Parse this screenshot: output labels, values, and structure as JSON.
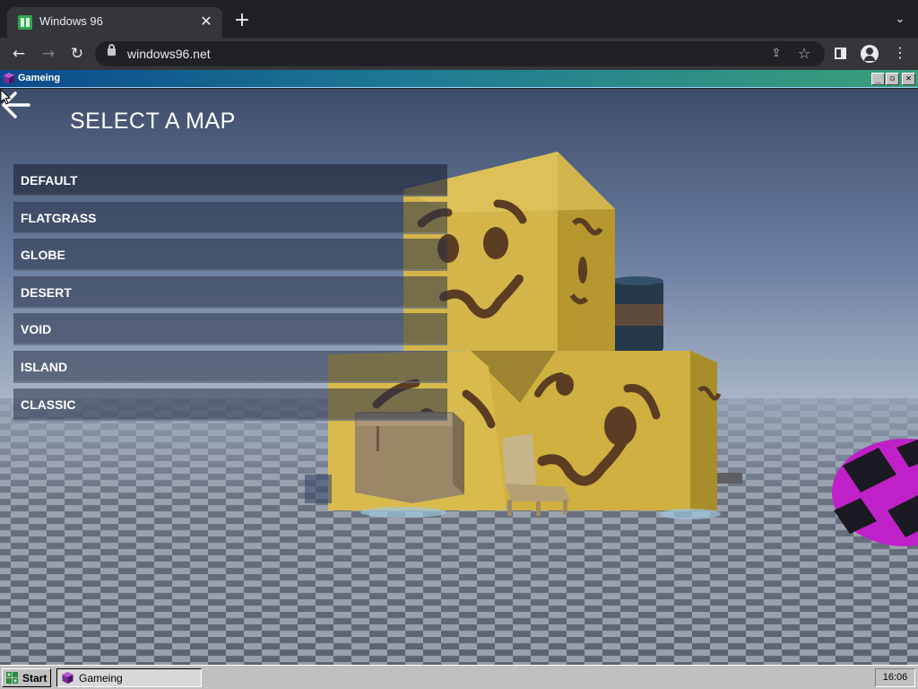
{
  "browser": {
    "tab_title": "Windows 96",
    "url": "windows96.net"
  },
  "window": {
    "title": "Gameing"
  },
  "game": {
    "menu_title": "SELECT A MAP",
    "maps": [
      "DEFAULT",
      "FLATGRASS",
      "GLOBE",
      "DESERT",
      "VOID",
      "ISLAND",
      "CLASSIC"
    ]
  },
  "taskbar": {
    "start_label": "Start",
    "task_label": "Gameing",
    "clock": "16:06"
  },
  "colors": {
    "titlebar_start": "#0b4a8c",
    "titlebar_end": "#3aa07a",
    "menu_item_bg": "rgba(40,50,72,0.55)",
    "sky_top": "#4a5a78",
    "floor_checker": "#5e6470",
    "box_yellow": "#d6b84a"
  },
  "icons": {
    "back": "arrow-left-icon",
    "app": "cube-purple-icon",
    "start": "windows-logo-icon"
  }
}
